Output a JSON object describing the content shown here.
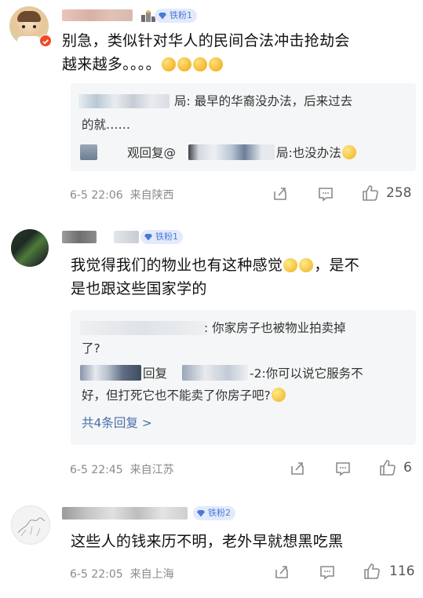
{
  "comments": [
    {
      "badge": "铁粉1",
      "text_line1": "别急，类似针对华人的民间合法冲击抢劫会",
      "text_line2": "越来越多。。。。",
      "replies": [
        {
          "prefix": "",
          "text": "局: 最早的华裔没办法，后来过去",
          "text2": "的就……"
        },
        {
          "prefix": "观回复@",
          "text": "局:也没办法"
        }
      ],
      "date": "6-5 22:06",
      "location": "来自陕西",
      "likes": "258"
    },
    {
      "badge": "铁粉1",
      "text_line1": "我觉得我们的物业也有这种感觉",
      "text_line1b": "，是不",
      "text_line2": "是也跟这些国家学的",
      "replies": [
        {
          "text": ": 你家房子也被物业拍卖掉",
          "text2": "了?"
        },
        {
          "prefix": "回复",
          "text": "-2:你可以说它服务不",
          "text2": "好，但打死它也不能卖了你房子吧?"
        }
      ],
      "more_replies": "共4条回复 >",
      "date": "6-5 22:45",
      "location": "来自江苏",
      "likes": "6"
    },
    {
      "badge": "铁粉2",
      "text_line1": "这些人的钱来历不明，老外早就想黑吃黑",
      "date": "6-5 22:05",
      "location": "来自上海",
      "likes": "116"
    }
  ],
  "icons": {
    "share": "share-icon",
    "comment": "comment-icon",
    "like": "thumbs-up-icon",
    "badge": "diamond-icon"
  },
  "colors": {
    "badge_bg": "#e3ebfb",
    "badge_text": "#4a79d8",
    "link": "#4a6ea9",
    "meta": "#8a8a8a"
  }
}
